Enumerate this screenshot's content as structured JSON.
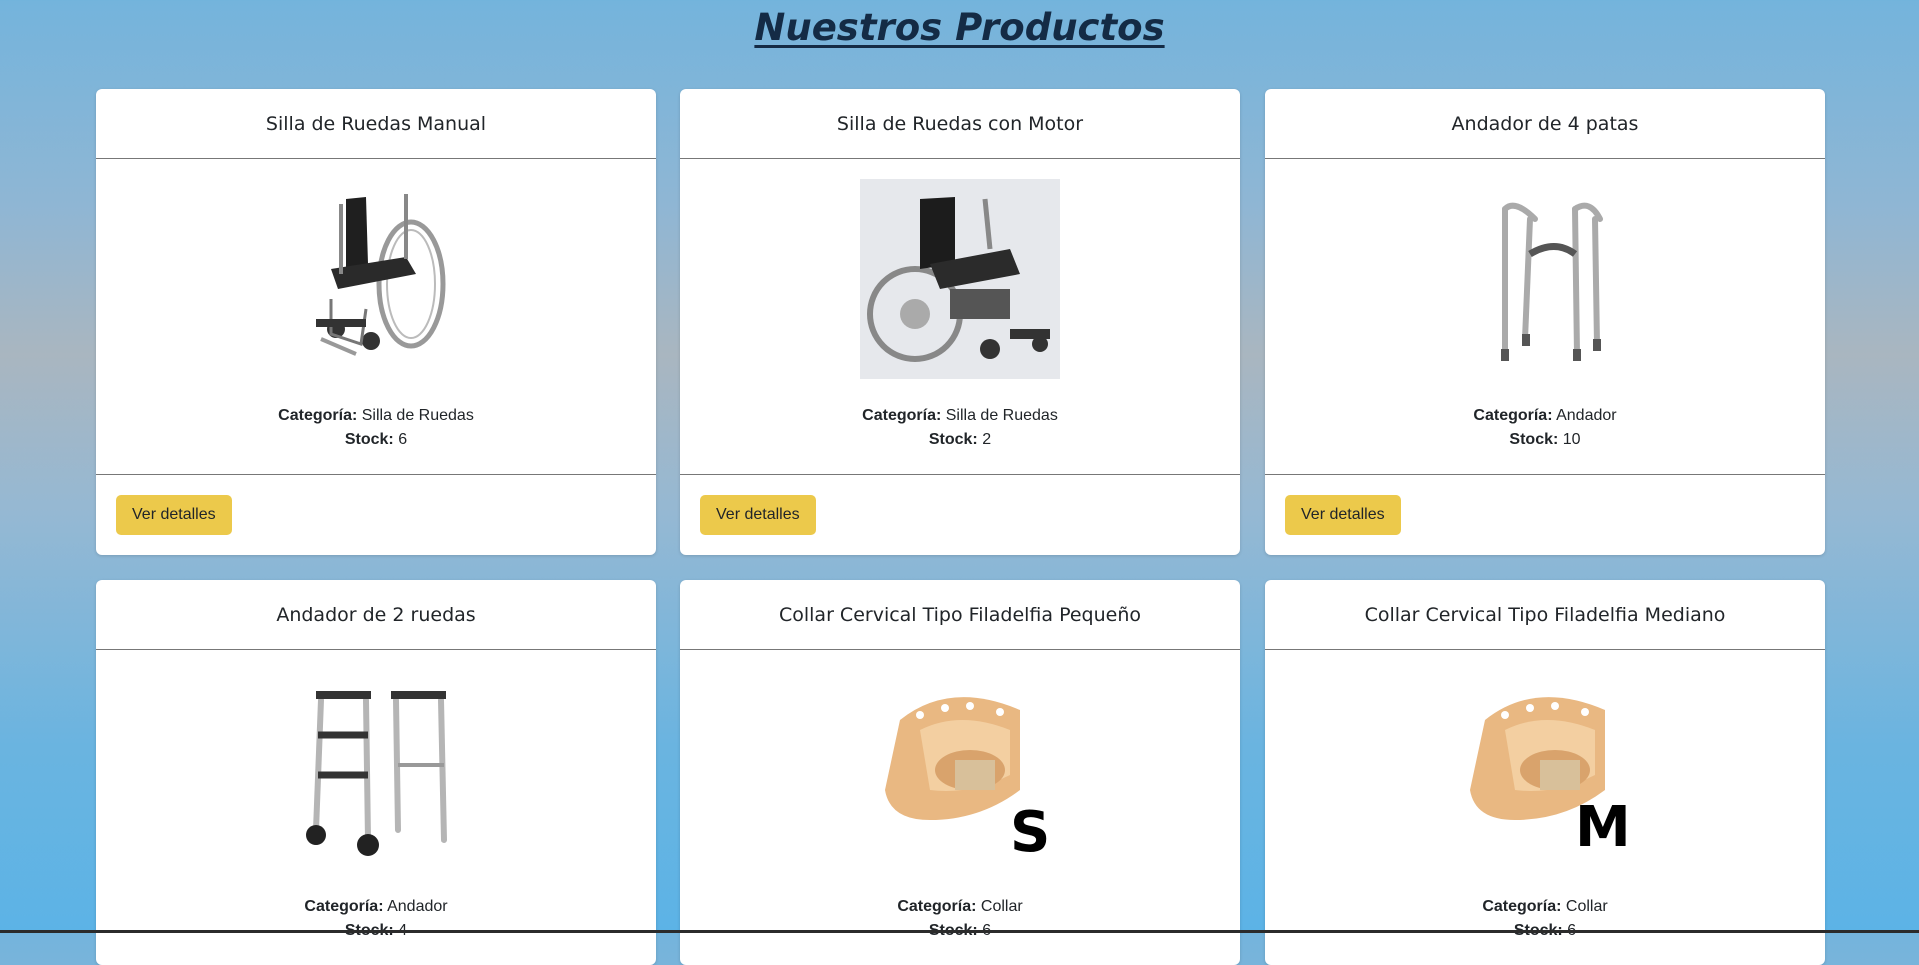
{
  "page": {
    "title": "Nuestros Productos"
  },
  "labels": {
    "category": "Categoría:",
    "stock": "Stock:",
    "details_button": "Ver detalles"
  },
  "products": [
    {
      "name": "Silla de Ruedas Manual",
      "category": "Silla de Ruedas",
      "stock": "6",
      "image_icon": "manual-wheelchair-image"
    },
    {
      "name": "Silla de Ruedas con Motor",
      "category": "Silla de Ruedas",
      "stock": "2",
      "image_icon": "motorized-wheelchair-image"
    },
    {
      "name": "Andador de 4 patas",
      "category": "Andador",
      "stock": "10",
      "image_icon": "four-leg-walker-image"
    },
    {
      "name": "Andador de 2 ruedas",
      "category": "Andador",
      "stock": "4",
      "image_icon": "two-wheel-walker-image"
    },
    {
      "name": "Collar Cervical Tipo Filadelfia Pequeño",
      "category": "Collar",
      "stock": "6",
      "image_icon": "cervical-collar-image",
      "size_mark": "S"
    },
    {
      "name": "Collar Cervical Tipo Filadelfia Mediano",
      "category": "Collar",
      "stock": "6",
      "image_icon": "cervical-collar-image",
      "size_mark": "M"
    }
  ],
  "colors": {
    "button": "#ecc94b",
    "title": "#142b45",
    "card": "#ffffff"
  }
}
